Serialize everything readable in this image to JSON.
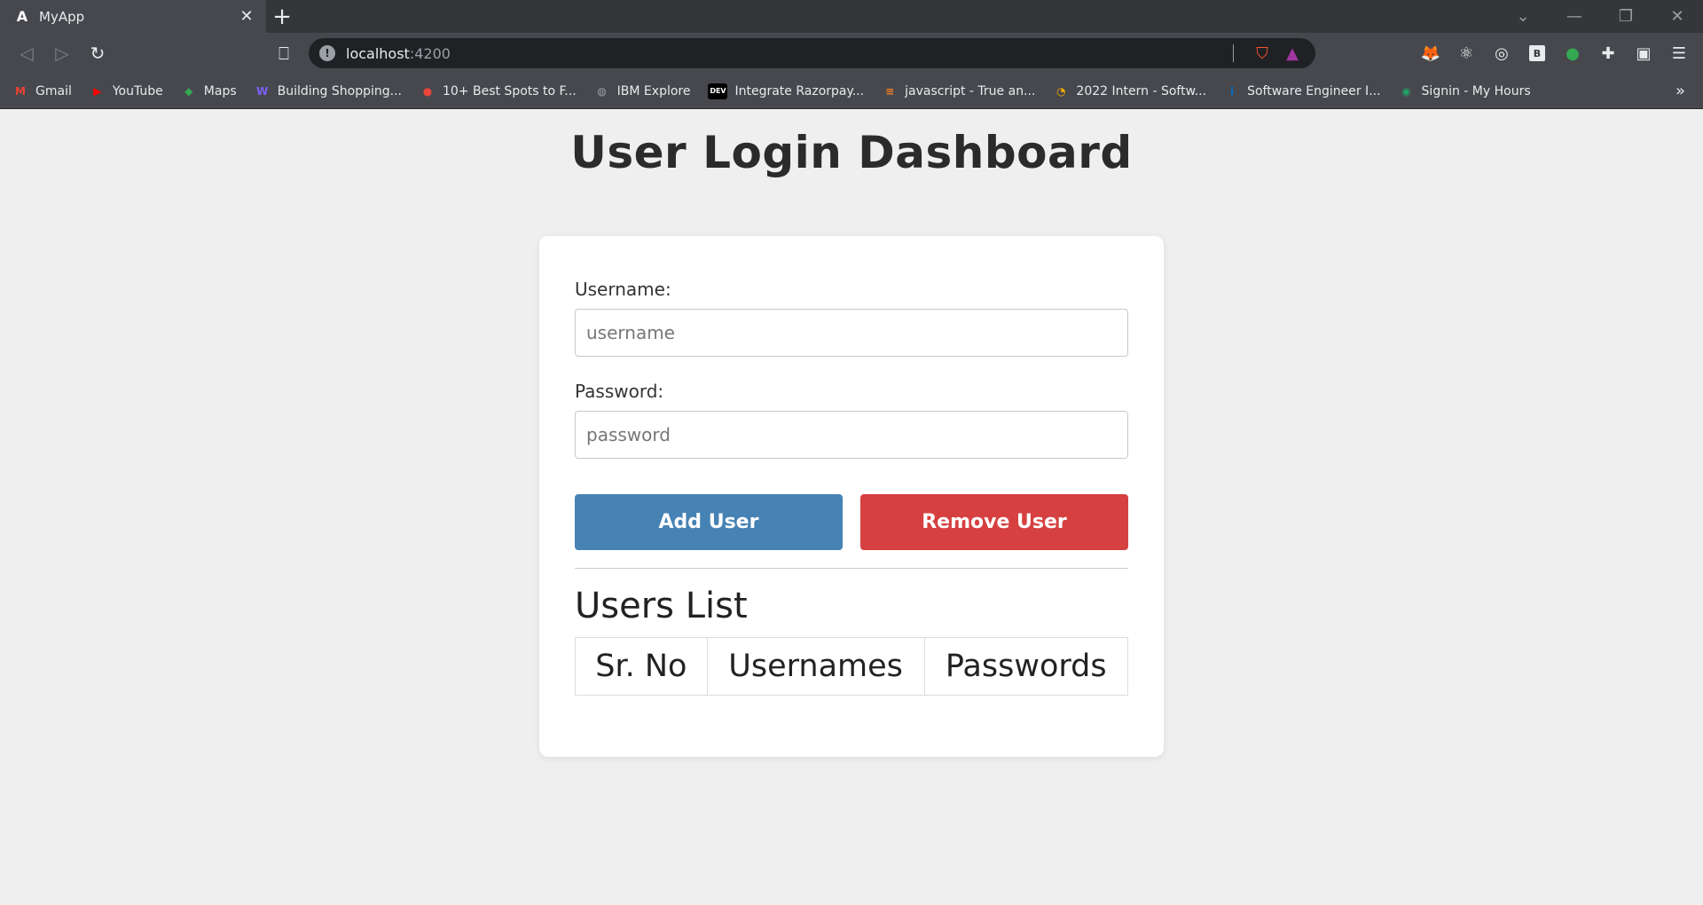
{
  "browser": {
    "tab_title": "MyApp",
    "tab_favicon": "A",
    "url_host": "localhost",
    "url_port": ":4200",
    "bookmarks": [
      {
        "label": "Gmail",
        "icon": "gmail-icon",
        "glyph": "M",
        "color": "#ea4335"
      },
      {
        "label": "YouTube",
        "icon": "youtube-icon",
        "glyph": "▶",
        "color": "#ff0000"
      },
      {
        "label": "Maps",
        "icon": "maps-icon",
        "glyph": "◆",
        "color": "#34a853"
      },
      {
        "label": "Building Shopping...",
        "icon": "wp-icon",
        "glyph": "W",
        "color": "#7b61ff"
      },
      {
        "label": "10+ Best Spots to F...",
        "icon": "fire-icon",
        "glyph": "●",
        "color": "#e8453c"
      },
      {
        "label": "IBM Explore",
        "icon": "globe-icon",
        "glyph": "◍",
        "color": "#9aa0a6"
      },
      {
        "label": "Integrate Razorpay...",
        "icon": "dev-icon",
        "glyph": "DEV",
        "color": "#000000"
      },
      {
        "label": "javascript - True an...",
        "icon": "stackoverflow-icon",
        "glyph": "≡",
        "color": "#f48024"
      },
      {
        "label": "2022 Intern - Softw...",
        "icon": "headset-icon",
        "glyph": "◔",
        "color": "#f9ab00"
      },
      {
        "label": "Software Engineer I...",
        "icon": "intel-icon",
        "glyph": "i",
        "color": "#0071c5"
      },
      {
        "label": "Signin - My Hours",
        "icon": "myhours-icon",
        "glyph": "◉",
        "color": "#21a366"
      }
    ]
  },
  "page": {
    "title": "User Login Dashboard",
    "username_label": "Username:",
    "username_placeholder": "username",
    "username_value": "",
    "password_label": "Password:",
    "password_placeholder": "password",
    "password_value": "",
    "add_button": "Add User",
    "remove_button": "Remove User",
    "list_title": "Users List",
    "table_headers": [
      "Sr. No",
      "Usernames",
      "Passwords"
    ]
  },
  "colors": {
    "add_button": "#4682b4",
    "remove_button": "#d64040"
  }
}
